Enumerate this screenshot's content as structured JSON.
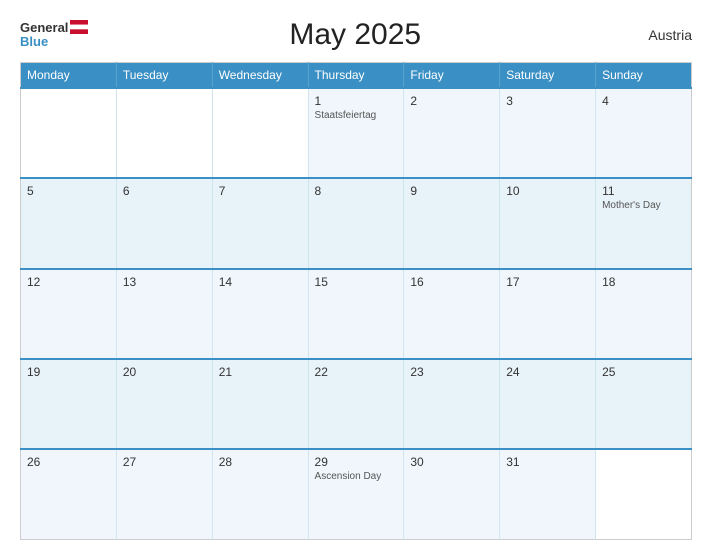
{
  "header": {
    "logo_general": "General",
    "logo_blue": "Blue",
    "title": "May 2025",
    "country": "Austria"
  },
  "calendar": {
    "days_of_week": [
      "Monday",
      "Tuesday",
      "Wednesday",
      "Thursday",
      "Friday",
      "Saturday",
      "Sunday"
    ],
    "weeks": [
      [
        {
          "num": "",
          "holiday": "",
          "empty": true
        },
        {
          "num": "",
          "holiday": "",
          "empty": true
        },
        {
          "num": "",
          "holiday": "",
          "empty": true
        },
        {
          "num": "1",
          "holiday": "Staatsfeiertag"
        },
        {
          "num": "2",
          "holiday": ""
        },
        {
          "num": "3",
          "holiday": ""
        },
        {
          "num": "4",
          "holiday": ""
        }
      ],
      [
        {
          "num": "5",
          "holiday": ""
        },
        {
          "num": "6",
          "holiday": ""
        },
        {
          "num": "7",
          "holiday": ""
        },
        {
          "num": "8",
          "holiday": ""
        },
        {
          "num": "9",
          "holiday": ""
        },
        {
          "num": "10",
          "holiday": ""
        },
        {
          "num": "11",
          "holiday": "Mother's Day"
        }
      ],
      [
        {
          "num": "12",
          "holiday": ""
        },
        {
          "num": "13",
          "holiday": ""
        },
        {
          "num": "14",
          "holiday": ""
        },
        {
          "num": "15",
          "holiday": ""
        },
        {
          "num": "16",
          "holiday": ""
        },
        {
          "num": "17",
          "holiday": ""
        },
        {
          "num": "18",
          "holiday": ""
        }
      ],
      [
        {
          "num": "19",
          "holiday": ""
        },
        {
          "num": "20",
          "holiday": ""
        },
        {
          "num": "21",
          "holiday": ""
        },
        {
          "num": "22",
          "holiday": ""
        },
        {
          "num": "23",
          "holiday": ""
        },
        {
          "num": "24",
          "holiday": ""
        },
        {
          "num": "25",
          "holiday": ""
        }
      ],
      [
        {
          "num": "26",
          "holiday": ""
        },
        {
          "num": "27",
          "holiday": ""
        },
        {
          "num": "28",
          "holiday": ""
        },
        {
          "num": "29",
          "holiday": "Ascension Day"
        },
        {
          "num": "30",
          "holiday": ""
        },
        {
          "num": "31",
          "holiday": ""
        },
        {
          "num": "",
          "holiday": "",
          "empty": true
        }
      ]
    ]
  }
}
